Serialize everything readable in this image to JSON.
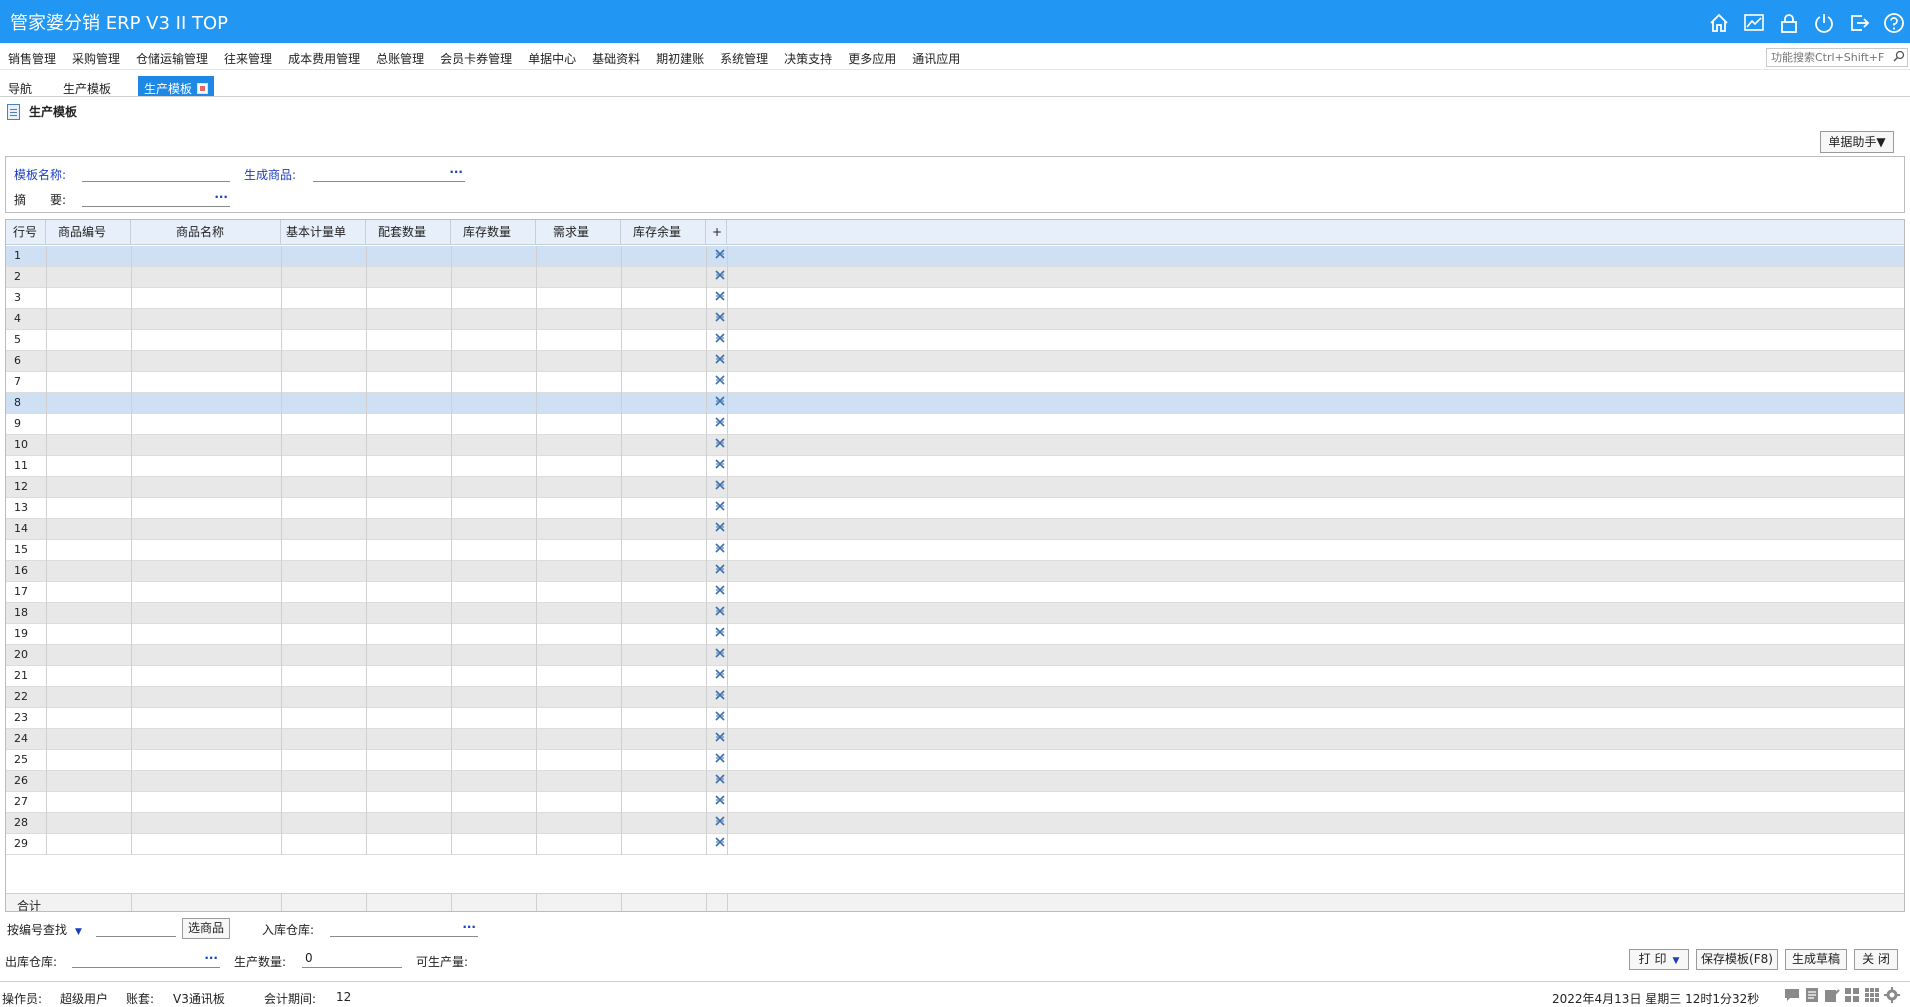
{
  "app": {
    "title": "管家婆分销 ERP V3 II TOP",
    "header_icons": [
      "home-icon",
      "chart-icon",
      "lock-icon",
      "power-icon",
      "exit-icon",
      "help-icon"
    ]
  },
  "menu": {
    "items": [
      "销售管理",
      "采购管理",
      "仓储运输管理",
      "往来管理",
      "成本费用管理",
      "总账管理",
      "会员卡券管理",
      "单据中心",
      "基础资料",
      "期初建账",
      "系统管理",
      "决策支持",
      "更多应用",
      "通讯应用"
    ],
    "search_placeholder": "功能搜索Ctrl+Shift+F"
  },
  "tabs": [
    {
      "label": "导航",
      "active": false
    },
    {
      "label": "生产模板",
      "active": false
    },
    {
      "label": "生产模板",
      "active": true
    }
  ],
  "page": {
    "title": "生产模板",
    "helper_button": "单据助手▼"
  },
  "form": {
    "template_name_label": "模板名称:",
    "template_name_value": "",
    "product_label": "生成商品:",
    "product_value": "",
    "summary_label": "摘　　要:",
    "summary_value": ""
  },
  "grid": {
    "columns": [
      "行号",
      "商品编号",
      "商品名称",
      "基本计量单",
      "配套数量",
      "库存数量",
      "需求量",
      "库存余量",
      "+"
    ],
    "row_numbers": [
      "1",
      "2",
      "3",
      "4",
      "5",
      "6",
      "7",
      "8",
      "9",
      "10",
      "11",
      "12",
      "13",
      "14",
      "15",
      "16",
      "17",
      "18",
      "19",
      "20",
      "21",
      "22",
      "23",
      "24",
      "25",
      "26",
      "27",
      "28",
      "29"
    ],
    "selected_rows": [
      1,
      8
    ],
    "totals_label": "合计"
  },
  "bottom": {
    "search_mode": "按编号查找",
    "search_value": "",
    "select_product_button": "选商品",
    "in_warehouse_label": "入库仓库:",
    "in_warehouse_value": "",
    "out_warehouse_label": "出库仓库:",
    "out_warehouse_value": "",
    "production_qty_label": "生产数量:",
    "production_qty_value": "0",
    "producible_label": "可生产量:",
    "producible_value": "",
    "print_button": "打 印",
    "save_template_button": "保存模板(F8)",
    "generate_draft_button": "生成草稿",
    "close_button": "关 闭"
  },
  "status": {
    "operator_label": "操作员:",
    "operator_value": "超级用户",
    "account_label": "账套:",
    "account_value": "V3通讯板",
    "period_label": "会计期间:",
    "period_value": "12",
    "datetime": "2022年4月13日  星期三  12时1分32秒"
  },
  "colors": {
    "titlebar": "#2196f3",
    "active_tab": "#1e88e5",
    "grid_header": "#e7f0fa",
    "selected_row": "#cfe0f5"
  }
}
